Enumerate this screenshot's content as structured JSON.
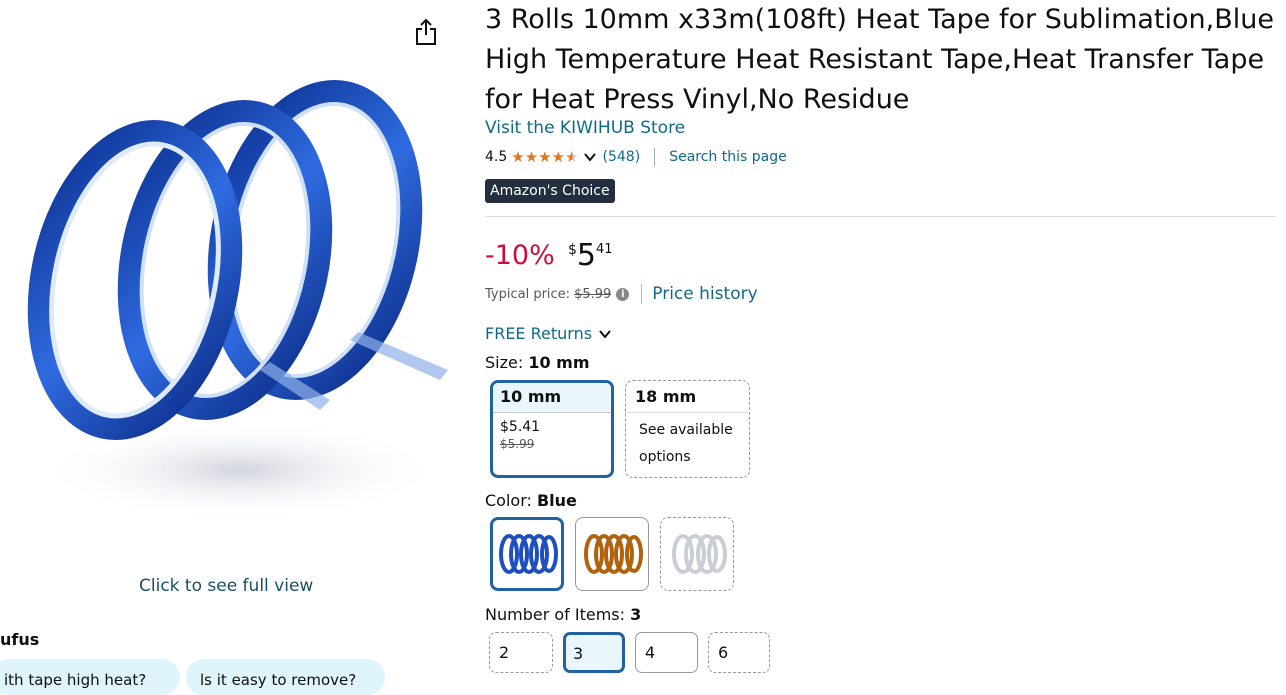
{
  "product": {
    "title": "3 Rolls 10mm x33m(108ft) Heat Tape for Sublimation,Blue High Temperature Heat Resistant Tape,Heat Transfer Tape for Heat Press Vinyl,No Residue",
    "store_link": "Visit the KIWIHUB Store",
    "rating": "4.5",
    "rating_count": "(548)",
    "search_page": "Search this page",
    "badge": "Amazon's Choice"
  },
  "gallery": {
    "full_view": "Click to see full view",
    "share_icon": "share-icon"
  },
  "rufus": {
    "label": "ufus",
    "chips": [
      "ith tape high heat?",
      "ls it easy to remove?"
    ]
  },
  "price": {
    "discount": "-10%",
    "symbol": "$",
    "whole": "5",
    "fraction": "41",
    "typical_label": "Typical price:",
    "typical_value": "$5.99",
    "history_link": "Price history"
  },
  "returns": "FREE Returns",
  "size": {
    "label": "Size:",
    "selected": "10 mm",
    "options": [
      {
        "name": "10 mm",
        "price": "$5.41",
        "list_price": "$5.99"
      },
      {
        "name": "18 mm",
        "note": "See available options"
      }
    ]
  },
  "color": {
    "label": "Color:",
    "selected": "Blue",
    "options": [
      "blue-tape-swatch",
      "amber-tape-swatch",
      "clear-tape-swatch"
    ]
  },
  "items": {
    "label": "Number of Items:",
    "selected": "3",
    "options": [
      "2",
      "3",
      "4",
      "6"
    ]
  },
  "colors": {
    "link": "#0f6a8a",
    "discount": "#cc0c39",
    "selected_border": "#2162a1",
    "star": "#de7921",
    "tape_blue": "#1f4fbf"
  }
}
